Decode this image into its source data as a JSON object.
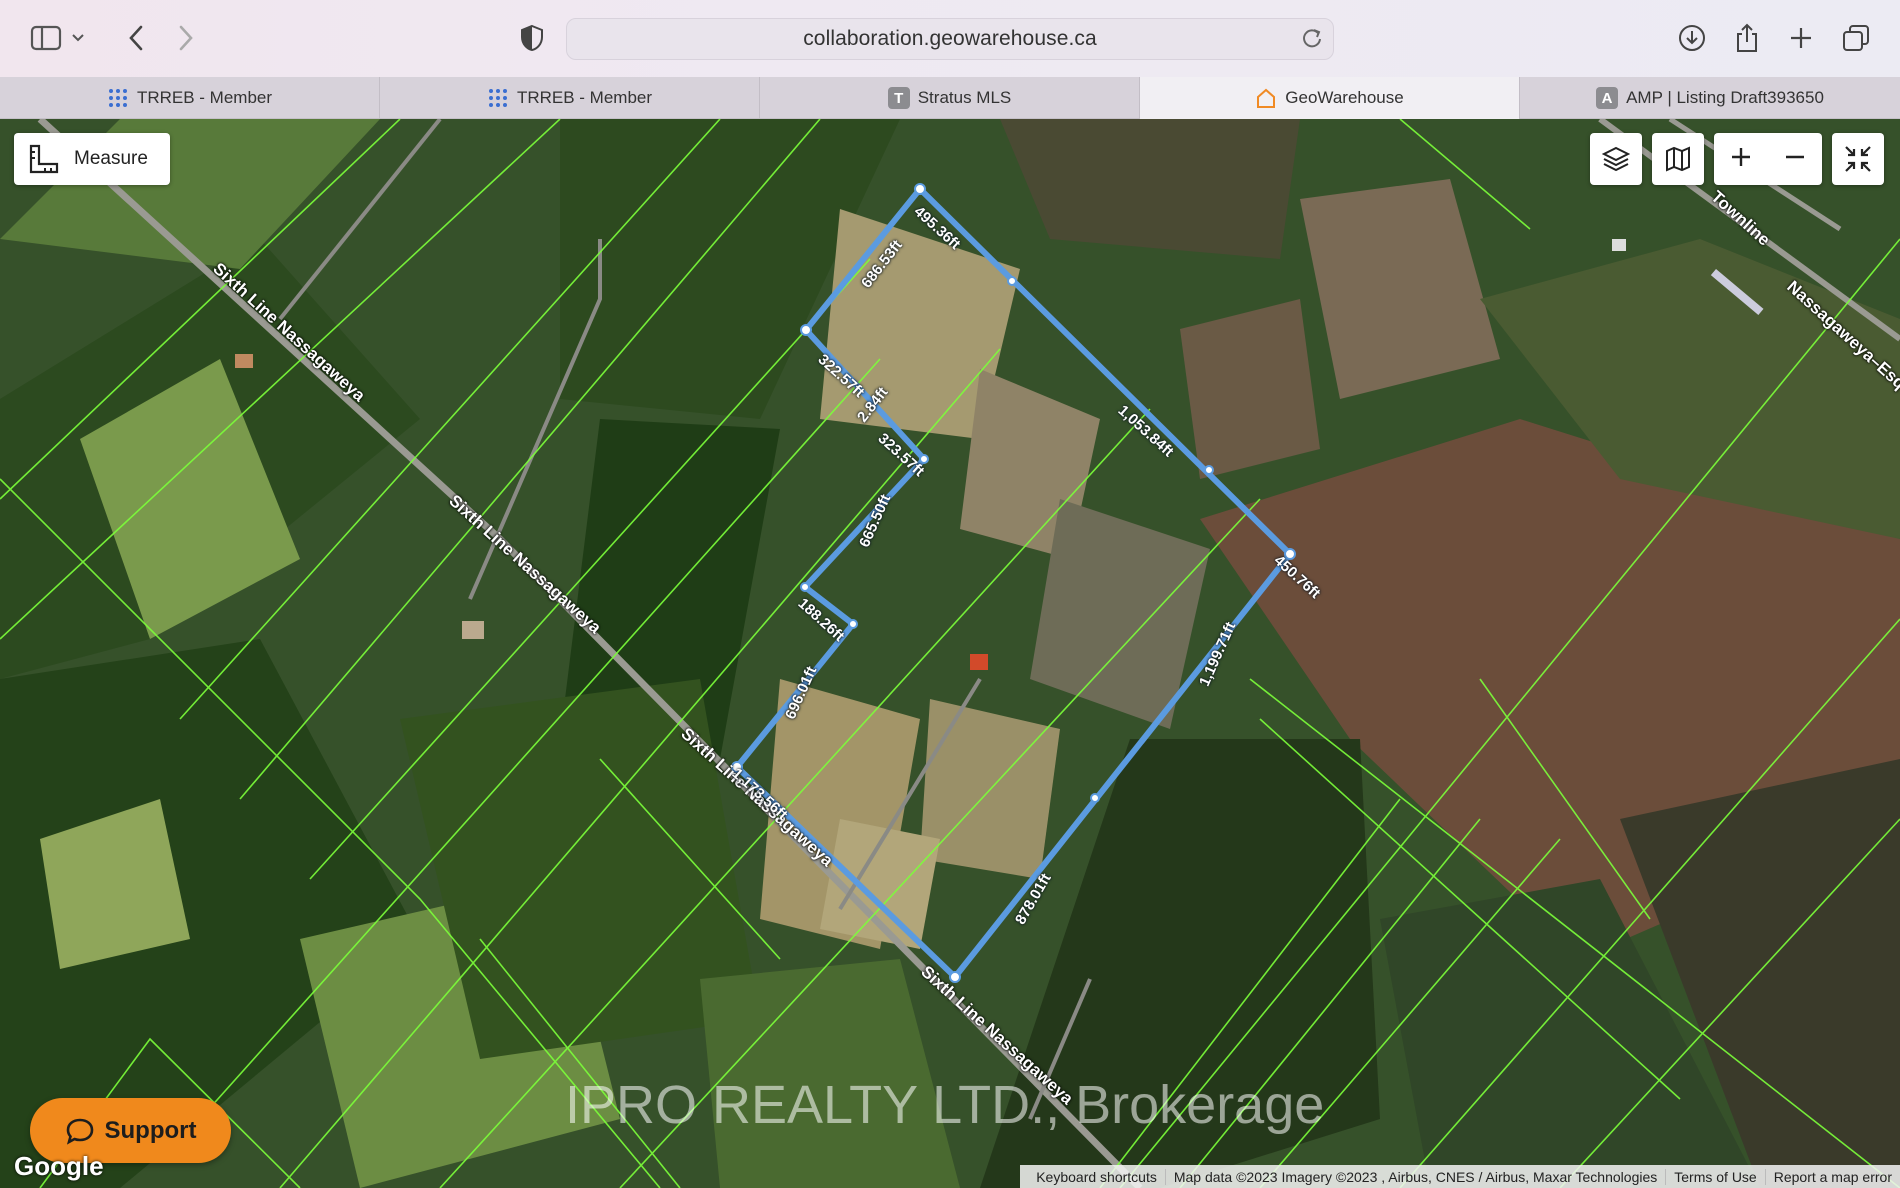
{
  "browser": {
    "url": "collaboration.geowarehouse.ca",
    "tabs": [
      {
        "label": "TRREB - Member",
        "icon": "trreb-dots-icon",
        "active": false
      },
      {
        "label": "TRREB - Member",
        "icon": "trreb-dots-icon",
        "active": false
      },
      {
        "label": "Stratus MLS",
        "icon": "letter-t-icon",
        "letter": "T",
        "active": false
      },
      {
        "label": "GeoWarehouse",
        "icon": "house-outline-icon",
        "active": true
      },
      {
        "label": "AMP | Listing Draft393650",
        "icon": "letter-a-icon",
        "letter": "A",
        "active": false
      }
    ]
  },
  "map": {
    "measure_label": "Measure",
    "roads": [
      {
        "label": "Sixth Line Nassagaweya"
      },
      {
        "label": "Sixth Line Nassagaweya"
      },
      {
        "label": "Sixth Line Nassagaweya"
      },
      {
        "label": "Sixth Line Nassagaweya"
      },
      {
        "label": "Nassagaweya–Esq"
      },
      {
        "label": "Townline"
      }
    ],
    "dimensions": [
      "495.36ft",
      "686.53ft",
      "1,053.84ft",
      "322.57ft",
      "2.84ft",
      "323.57ft",
      "665.50ft",
      "188.26ft",
      "450.76ft",
      "1,199.71ft",
      "696.01ft",
      "1,173.56ft",
      "878.01ft"
    ],
    "support_label": "Support",
    "watermark": "IPRO REALTY LTD., Brokerage",
    "google_label": "Google",
    "attribution": {
      "keyboard": "Keyboard shortcuts",
      "map_data": "Map data ©2023 Imagery ©2023 , Airbus, CNES / Airbus, Maxar Technologies",
      "terms": "Terms of Use",
      "report": "Report a map error"
    },
    "colors": {
      "outline": "#5b9be0",
      "parcel_lines": "#7cff3a",
      "support_bg": "#f0891c"
    }
  }
}
